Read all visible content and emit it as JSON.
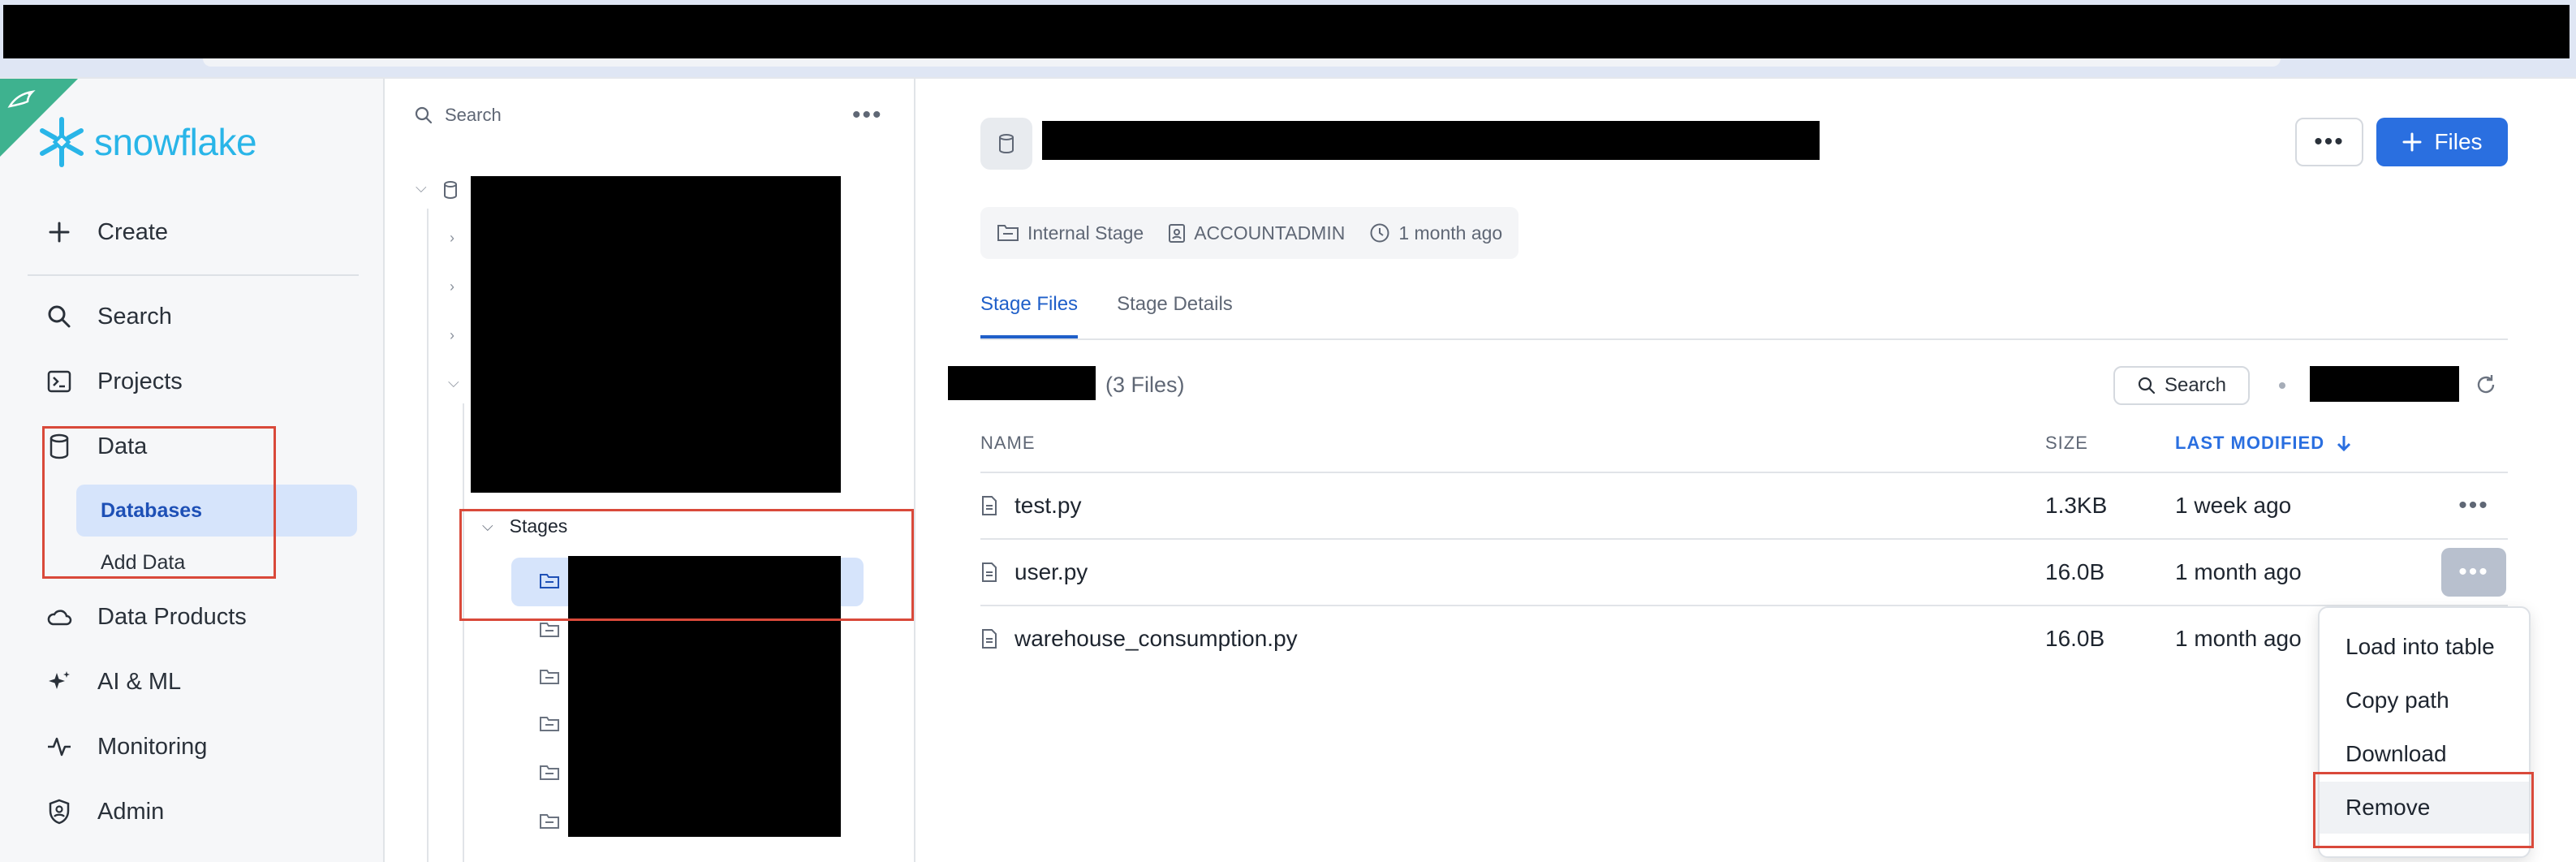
{
  "brand": {
    "name": "snowflake",
    "color": "#29b5e8"
  },
  "nav": {
    "create": "Create",
    "items": [
      {
        "label": "Search",
        "icon": "search-icon"
      },
      {
        "label": "Projects",
        "icon": "terminal-icon"
      },
      {
        "label": "Data",
        "icon": "database-icon"
      },
      {
        "label": "Data Products",
        "icon": "cloud-icon"
      },
      {
        "label": "AI & ML",
        "icon": "sparkle-icon"
      },
      {
        "label": "Monitoring",
        "icon": "activity-icon"
      },
      {
        "label": "Admin",
        "icon": "shield-icon"
      }
    ],
    "data_sub": [
      {
        "label": "Databases",
        "active": true
      },
      {
        "label": "Add Data",
        "active": false
      }
    ]
  },
  "tree": {
    "search_placeholder": "Search",
    "stages_label": "Stages"
  },
  "main": {
    "meta": {
      "stage_type": "Internal Stage",
      "owner": "ACCOUNTADMIN",
      "modified": "1 month ago"
    },
    "files_button": "Files",
    "tabs": [
      {
        "label": "Stage Files",
        "active": true
      },
      {
        "label": "Stage Details",
        "active": false
      }
    ],
    "file_count": "(3 Files)",
    "search_button": "Search",
    "columns": {
      "name": "NAME",
      "size": "SIZE",
      "modified": "LAST MODIFIED"
    },
    "rows": [
      {
        "name": "test.py",
        "size": "1.3KB",
        "modified": "1 week ago"
      },
      {
        "name": "user.py",
        "size": "16.0B",
        "modified": "1 month ago"
      },
      {
        "name": "warehouse_consumption.py",
        "size": "16.0B",
        "modified": "1 month ago"
      }
    ],
    "context_menu": [
      "Load into table",
      "Copy path",
      "Download",
      "Remove"
    ]
  },
  "colors": {
    "accent": "#2a6fe0",
    "highlight": "#d9493a",
    "corner": "#3eb28f"
  }
}
